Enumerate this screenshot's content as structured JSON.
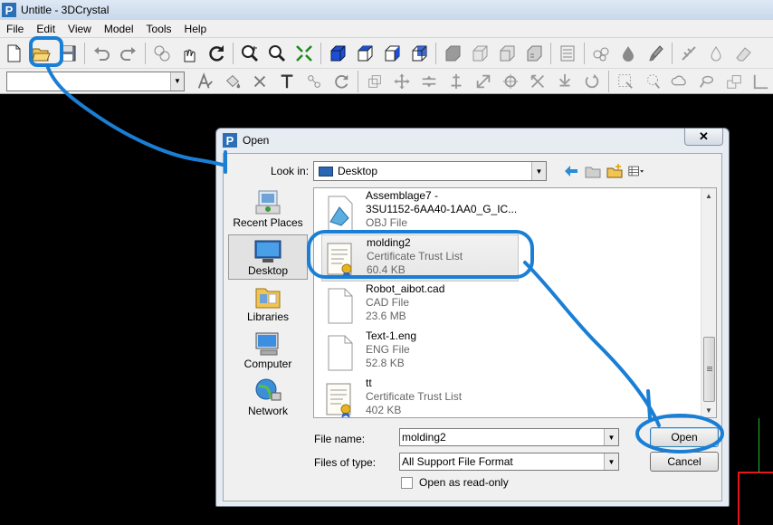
{
  "window": {
    "title": "Untitle - 3DCrystal",
    "app_icon": "P"
  },
  "menu": [
    "File",
    "Edit",
    "View",
    "Model",
    "Tools",
    "Help"
  ],
  "toolbar": {
    "row1_icons": [
      "new-file-icon",
      "open-folder-icon",
      "save-icon",
      "undo-icon",
      "redo-icon",
      "select-icon",
      "pick-icon",
      "rotate-icon",
      "zoom-in-icon",
      "zoom-window-icon",
      "zoom-fit-icon",
      "view-front-icon",
      "view-top-icon",
      "view-right-icon",
      "view-iso-icon",
      "shaded-icon",
      "wireframe-icon",
      "hidden-icon",
      "edges-icon",
      "layers-icon",
      "material-icon",
      "drop-icon",
      "brush-icon",
      "measure-icon",
      "drop2-icon",
      "eraser-icon"
    ],
    "row2_icons": [
      "text-style-icon",
      "paint-bucket-icon",
      "delete-x-icon",
      "text-icon",
      "link-icon",
      "refresh-icon",
      "move-icon",
      "arrows-icon",
      "scale-icon",
      "align-icon",
      "stretch-icon",
      "rotate3d-icon",
      "mirror-icon",
      "array-icon",
      "revolve-icon",
      "select-box-icon",
      "lasso-icon",
      "cloud-icon",
      "search-icon",
      "dimension-icon",
      "frame-icon"
    ],
    "combo_value": ""
  },
  "dialog": {
    "title": "Open",
    "close_label": "✕",
    "look_in_label": "Look in:",
    "look_in_value": "Desktop",
    "places": [
      {
        "label": "Recent Places",
        "icon": "recent-places-icon",
        "selected": false
      },
      {
        "label": "Desktop",
        "icon": "desktop-icon",
        "selected": true
      },
      {
        "label": "Libraries",
        "icon": "libraries-icon",
        "selected": false
      },
      {
        "label": "Computer",
        "icon": "computer-icon",
        "selected": false
      },
      {
        "label": "Network",
        "icon": "network-icon",
        "selected": false
      }
    ],
    "files": [
      {
        "name": "Assemblage7 -\n3SU1152-6AA40-1AA0_G_IC...",
        "type": "OBJ File",
        "size": "",
        "icon": "obj-file-icon",
        "selected": false
      },
      {
        "name": "molding2",
        "type": "Certificate Trust List",
        "size": "60.4 KB",
        "icon": "certificate-icon",
        "selected": true
      },
      {
        "name": "Robot_aibot.cad",
        "type": "CAD File",
        "size": "23.6 MB",
        "icon": "blank-file-icon",
        "selected": false
      },
      {
        "name": "Text-1.eng",
        "type": "ENG File",
        "size": "52.8 KB",
        "icon": "blank-file-icon",
        "selected": false
      },
      {
        "name": "tt",
        "type": "Certificate Trust List",
        "size": "402 KB",
        "icon": "certificate-icon",
        "selected": false
      }
    ],
    "file_name_label": "File name:",
    "file_name_value": "molding2",
    "files_of_type_label": "Files of type:",
    "files_of_type_value": "All Support File Format",
    "read_only_label": "Open as read-only",
    "read_only_checked": false,
    "open_button": "Open",
    "cancel_button": "Cancel"
  },
  "annotation_color": "#1a7fd4"
}
